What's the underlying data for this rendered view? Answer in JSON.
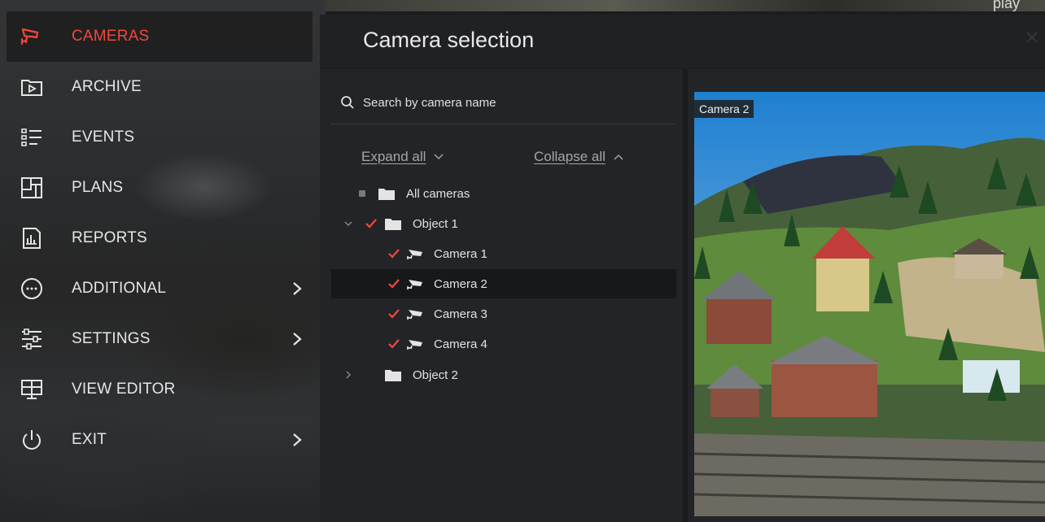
{
  "top_strip": {
    "title": "play"
  },
  "nav": {
    "items": [
      {
        "label": "CAMERAS",
        "icon": "camera-icon",
        "active": true
      },
      {
        "label": "ARCHIVE",
        "icon": "archive-play-icon"
      },
      {
        "label": "EVENTS",
        "icon": "events-list-icon"
      },
      {
        "label": "PLANS",
        "icon": "plans-icon"
      },
      {
        "label": "REPORTS",
        "icon": "reports-icon"
      },
      {
        "label": "ADDITIONAL",
        "icon": "more-icon",
        "submenu": true
      },
      {
        "label": "SETTINGS",
        "icon": "sliders-icon",
        "submenu": true
      },
      {
        "label": "VIEW EDITOR",
        "icon": "monitor-icon"
      },
      {
        "label": "EXIT",
        "icon": "power-icon",
        "submenu": true
      }
    ]
  },
  "dialog": {
    "title": "Camera selection",
    "search": {
      "placeholder": "Search by camera name",
      "value": ""
    },
    "expand_all": "Expand all",
    "collapse_all": "Collapse all",
    "tree": [
      {
        "label": "All cameras",
        "type": "root"
      },
      {
        "label": "Object 1",
        "type": "folder",
        "expanded": true,
        "checked": true
      },
      {
        "label": "Camera 1",
        "type": "camera",
        "checked": true
      },
      {
        "label": "Camera 2",
        "type": "camera",
        "checked": true,
        "selected": true
      },
      {
        "label": "Camera 3",
        "type": "camera",
        "checked": true
      },
      {
        "label": "Camera 4",
        "type": "camera",
        "checked": true
      },
      {
        "label": "Object 2",
        "type": "folder",
        "expanded": false,
        "checked": false
      }
    ],
    "preview_label": "Camera 2"
  },
  "colors": {
    "accent": "#f2483c",
    "panel": "#232427",
    "text": "#e2e2e2"
  }
}
